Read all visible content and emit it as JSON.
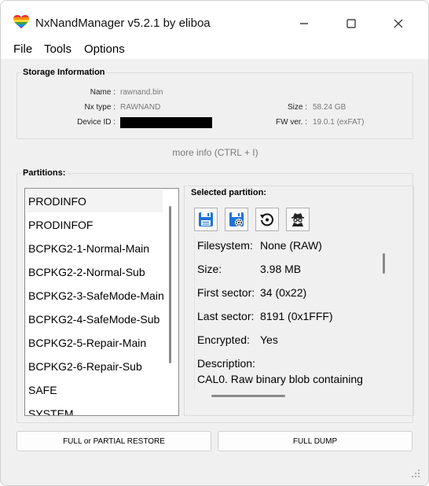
{
  "window": {
    "title": "NxNandManager v5.2.1 by eliboa",
    "icons": {
      "app": "rainbow-heart-icon",
      "minimize": "minimize-icon",
      "maximize": "maximize-icon",
      "close": "close-icon"
    }
  },
  "menu": [
    "File",
    "Tools",
    "Options"
  ],
  "storage": {
    "title": "Storage Information",
    "name_label": "Name :",
    "name_value": "rawnand.bin",
    "type_label": "Nx type :",
    "type_value": "RAWNAND",
    "device_label": "Device ID :",
    "size_label": "Size :",
    "size_value": "58.24 GB",
    "fw_label": "FW ver. :",
    "fw_value": "19.0.1 (exFAT)"
  },
  "more_info": "more info (CTRL + I)",
  "partitions": {
    "title": "Partitions:",
    "selected_index": 0,
    "items": [
      "PRODINFO",
      "PRODINFOF",
      "BCPKG2-1-Normal-Main",
      "BCPKG2-2-Normal-Sub",
      "BCPKG2-3-SafeMode-Main",
      "BCPKG2-4-SafeMode-Sub",
      "BCPKG2-5-Repair-Main",
      "BCPKG2-6-Repair-Sub",
      "SAFE",
      "SYSTEM"
    ]
  },
  "selected_partition": {
    "title": "Selected partition:",
    "tools": [
      "save-icon",
      "save-settings-icon",
      "restore-icon",
      "spy-icon"
    ],
    "fields": [
      {
        "label": "Filesystem:",
        "value": "None (RAW)"
      },
      {
        "label": "Size:",
        "value": "3.98 MB"
      },
      {
        "label": "First sector:",
        "value": "34 (0x22)"
      },
      {
        "label": "Last sector:",
        "value": "8191 (0x1FFF)"
      },
      {
        "label": "Encrypted:",
        "value": "Yes"
      }
    ],
    "description_label": "Description:",
    "description_value": "CAL0. Raw binary blob containing"
  },
  "buttons": {
    "restore": "FULL or PARTIAL RESTORE",
    "dump": "FULL DUMP"
  },
  "colors": {
    "accent": "#1e6fd9",
    "disk_blue": "#1f73d4"
  }
}
